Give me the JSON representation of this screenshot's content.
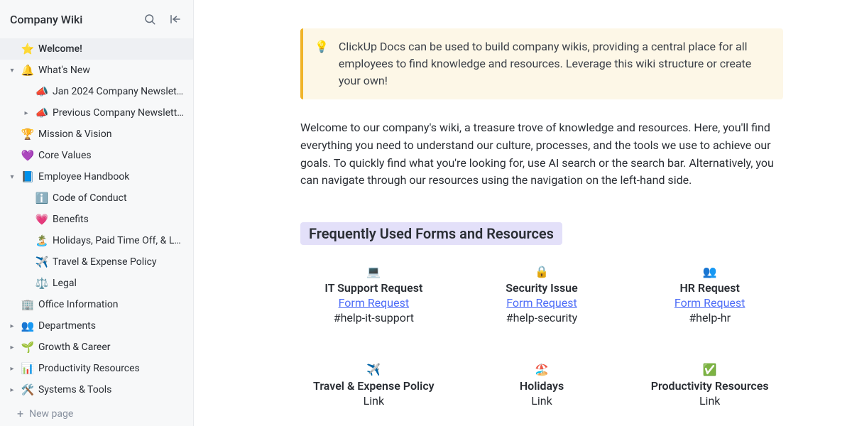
{
  "sidebar": {
    "title": "Company Wiki",
    "new_page": "New page",
    "items": [
      {
        "icon": "⭐",
        "label": "Welcome!",
        "active": true,
        "chevron": "",
        "depth": 0
      },
      {
        "icon": "🔔",
        "label": "What's New",
        "active": false,
        "chevron": "down",
        "depth": 0
      },
      {
        "icon": "📣",
        "label": "Jan 2024 Company Newsletter",
        "active": false,
        "chevron": "",
        "depth": 1
      },
      {
        "icon": "📣",
        "label": "Previous Company Newsletters",
        "active": false,
        "chevron": "right",
        "depth": 1
      },
      {
        "icon": "🏆",
        "label": "Mission & Vision",
        "active": false,
        "chevron": "",
        "depth": 0
      },
      {
        "icon": "💜",
        "label": "Core Values",
        "active": false,
        "chevron": "",
        "depth": 0
      },
      {
        "icon": "📘",
        "label": "Employee Handbook",
        "active": false,
        "chevron": "down",
        "depth": 0
      },
      {
        "icon": "ℹ️",
        "label": "Code of Conduct",
        "active": false,
        "chevron": "",
        "depth": 1
      },
      {
        "icon": "💗",
        "label": "Benefits",
        "active": false,
        "chevron": "",
        "depth": 1
      },
      {
        "icon": "🏝️",
        "label": "Holidays, Paid Time Off, & Leave...",
        "active": false,
        "chevron": "",
        "depth": 1
      },
      {
        "icon": "✈️",
        "label": "Travel & Expense Policy",
        "active": false,
        "chevron": "",
        "depth": 1
      },
      {
        "icon": "⚖️",
        "label": "Legal",
        "active": false,
        "chevron": "",
        "depth": 1
      },
      {
        "icon": "🏢",
        "label": "Office Information",
        "active": false,
        "chevron": "",
        "depth": 0
      },
      {
        "icon": "👥",
        "label": "Departments",
        "active": false,
        "chevron": "right",
        "depth": 0
      },
      {
        "icon": "🌱",
        "label": "Growth & Career",
        "active": false,
        "chevron": "right",
        "depth": 0
      },
      {
        "icon": "📊",
        "label": "Productivity Resources",
        "active": false,
        "chevron": "right",
        "depth": 0
      },
      {
        "icon": "🛠️",
        "label": "Systems & Tools",
        "active": false,
        "chevron": "right",
        "depth": 0
      }
    ]
  },
  "callout": {
    "icon": "💡",
    "text": "ClickUp Docs can be used to build company wikis, providing a central place for all employees to find knowledge and resources. Leverage this wiki structure or create your own!"
  },
  "intro": "Welcome to our company's wiki, a treasure trove of knowledge and resources. Here, you'll find everything you need to understand our culture, processes, and the tools we use to achieve our goals. To quickly find what you're looking for, use AI search or the search bar. Alternatively, you can navigate through our resources using the navigation on the left-hand side.",
  "section_header": "Frequently Used Forms and Resources",
  "cards": [
    {
      "emoji": "💻",
      "title": "IT Support Request",
      "link": "Form Request",
      "sub": "#help-it-support",
      "linked": true
    },
    {
      "emoji": "🔒",
      "title": "Security Issue",
      "link": "Form Request",
      "sub": "#help-security",
      "linked": true
    },
    {
      "emoji": "👥",
      "title": "HR Request",
      "link": "Form Request",
      "sub": "#help-hr",
      "linked": true
    },
    {
      "emoji": "✈️",
      "title": "Travel & Expense Policy",
      "link": "Link",
      "sub": "",
      "linked": false
    },
    {
      "emoji": "🏖️",
      "title": "Holidays",
      "link": "Link",
      "sub": "",
      "linked": false
    },
    {
      "emoji": "✅",
      "title": "Productivity Resources",
      "link": "Link",
      "sub": "",
      "linked": false
    }
  ]
}
